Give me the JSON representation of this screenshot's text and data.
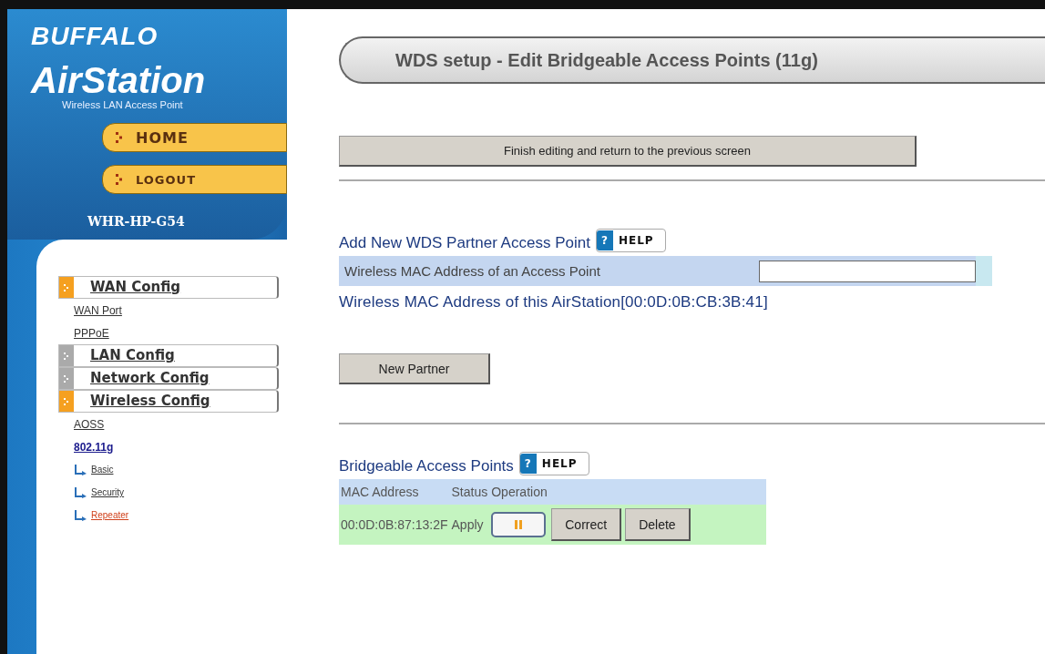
{
  "brand": {
    "maker": "BUFFALO",
    "product": "AirStation",
    "tagline": "Wireless LAN Access Point"
  },
  "top_buttons": [
    {
      "label": "HOME"
    },
    {
      "label": "LOGOUT"
    }
  ],
  "model": "WHR-HP-G54",
  "nav": [
    {
      "label": "WAN Config",
      "expanded": true,
      "children": [
        {
          "label": "WAN Port",
          "color": "#333333"
        },
        {
          "label": "PPPoE",
          "color": "#333333"
        }
      ]
    },
    {
      "label": "LAN Config",
      "expanded": false
    },
    {
      "label": "Network Config",
      "expanded": false
    },
    {
      "label": "Wireless Config",
      "expanded": true,
      "children": [
        {
          "label": "AOSS",
          "color": "#333333"
        },
        {
          "label": "802.11g",
          "color": "#1a1a8c",
          "children": [
            {
              "label": "Basic",
              "color": "#333333"
            },
            {
              "label": "Security",
              "color": "#333333"
            },
            {
              "label": "Repeater",
              "color": "#d0401a"
            }
          ]
        }
      ]
    }
  ],
  "page_title": "WDS setup - Edit Bridgeable Access Points (**11g**)",
  "finish_button": "Finish editing and return to the previous screen",
  "add_section": {
    "heading": "Add New WDS Partner Access Point",
    "help": {
      "icon": "?",
      "label": "HELP"
    },
    "field_label": "Wireless MAC Address of an Access Point",
    "own_mac": "Wireless MAC Address of this AirStation[00:0D:0B:CB:3B:41]",
    "button": "New Partner"
  },
  "list_section": {
    "heading": "Bridgeable Access Points",
    "help": {
      "icon": "?",
      "label": "HELP"
    },
    "columns": [
      "MAC Address",
      "Status",
      "Operation"
    ],
    "rows": [
      {
        "mac": "00:0D:0B:87:13:2F",
        "status": "Apply",
        "actions": [
          "Correct",
          "Delete"
        ]
      }
    ]
  }
}
